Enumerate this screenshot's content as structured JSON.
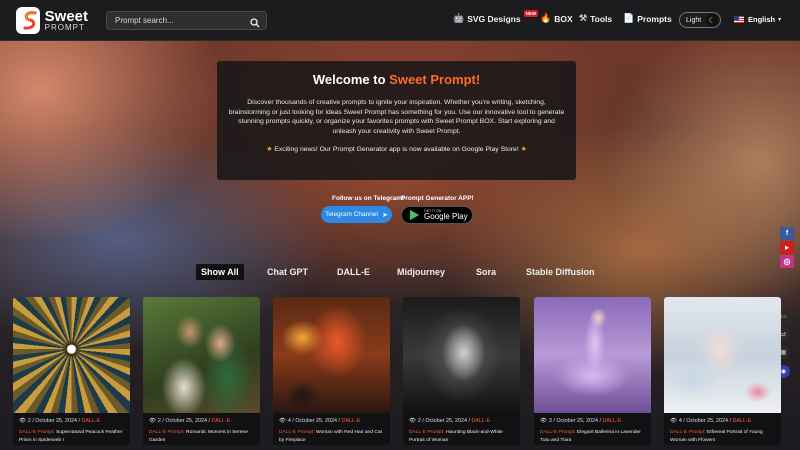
{
  "header": {
    "logo": {
      "line1": "Sweet",
      "line2": "PROMPT"
    },
    "search_placeholder": "Prompt search...",
    "nav": [
      {
        "label": "SVG Designs",
        "icon": "robot-icon",
        "badge": "NEW"
      },
      {
        "label": "BOX",
        "icon": "fire-icon"
      },
      {
        "label": "Tools",
        "icon": "tools-icon"
      },
      {
        "label": "Prompts",
        "icon": "document-icon"
      }
    ],
    "theme_toggle": {
      "label": "Light",
      "icon": "moon-icon"
    },
    "language": {
      "label": "English",
      "icon": "us-flag-icon"
    }
  },
  "welcome": {
    "title_prefix": "Welcome to ",
    "title_brand": "Sweet Prompt!",
    "description": "Discover thousands of creative prompts to ignite your inspiration. Whether you're writing, sketching, brainstorming or just looking for ideas Sweet Prompt has something for you. Use our innovative tool to generate stunning prompts quickly, or organize your favorites prompts with Sweet Prompt BOX. Start exploring and unleash your creativity with Sweet Prompt.",
    "news": "Exciting news! Our Prompt Generator app is now available on Google Play Store!"
  },
  "cta": {
    "telegram_label": "Follow us on Telegram!",
    "telegram_button": "Telegram Channel",
    "app_label": "Prompt Generator APP!",
    "google_play_small": "GET IT ON",
    "google_play_big": "Google Play"
  },
  "social": [
    "f",
    "▶",
    "◎"
  ],
  "tabs": [
    {
      "label": "Show All",
      "active": true
    },
    {
      "label": "Chat GPT",
      "active": false
    },
    {
      "label": "DALL-E",
      "active": false
    },
    {
      "label": "Midjourney",
      "active": false
    },
    {
      "label": "Sora",
      "active": false
    },
    {
      "label": "Stable Diffusion",
      "active": false
    }
  ],
  "cards": [
    {
      "views": "2",
      "date": "October 25, 2024",
      "model": "DALL-E",
      "tag": "DALL-E Prompt:",
      "title": "Supernatural Peacock Feather Prism in Spiderweb I"
    },
    {
      "views": "2",
      "date": "October 25, 2024",
      "model": "DALL-E",
      "tag": "DALL-E Prompt:",
      "title": "Romantic Moment in Serene Garden"
    },
    {
      "views": "4",
      "date": "October 25, 2024",
      "model": "DALL-E",
      "tag": "DALL-E Prompt:",
      "title": "Woman with Red Hair and Cat by Fireplace"
    },
    {
      "views": "2",
      "date": "October 25, 2024",
      "model": "DALL-E",
      "tag": "DALL-E Prompt:",
      "title": "Haunting Black-and-White Portrait of Woman"
    },
    {
      "views": "3",
      "date": "October 25, 2024",
      "model": "DALL-E",
      "tag": "DALL-E Prompt:",
      "title": "Elegant Ballerina in Lavender Tutu and Tiara"
    },
    {
      "views": "4",
      "date": "October 25, 2024",
      "model": "DALL-E",
      "tag": "DALL-E Prompt:",
      "title": "Ethereal Portrait of Young Woman with Flowers"
    }
  ]
}
